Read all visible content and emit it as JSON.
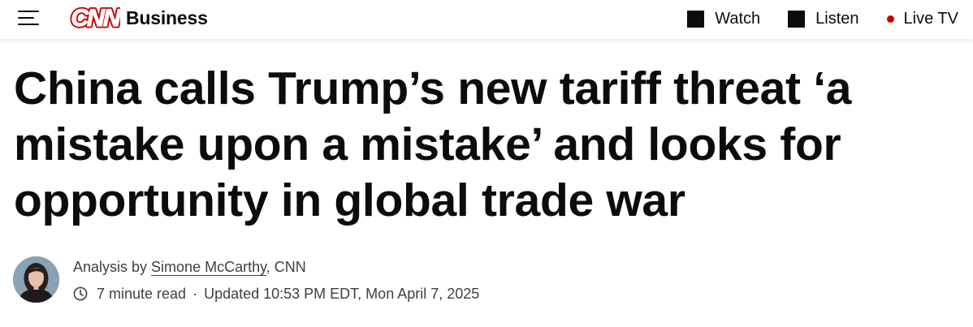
{
  "header": {
    "menu_icon": "hamburger-menu-icon",
    "logo_text": "CNN",
    "section": "Business",
    "nav": [
      {
        "label": "Watch",
        "icon": "square-icon"
      },
      {
        "label": "Listen",
        "icon": "square-icon"
      },
      {
        "label": "Live TV",
        "icon": "live-dot-icon"
      }
    ]
  },
  "article": {
    "headline": "China calls Trump’s new tariff threat ‘a mistake upon a mistake’ and looks for opportunity in global trade war",
    "byline": {
      "prefix": "Analysis by ",
      "author": "Simone McCarthy",
      "suffix": ", CNN"
    },
    "read_time": "7 minute read",
    "separator": "·",
    "updated": "Updated 10:53 PM EDT, Mon April 7, 2025"
  },
  "colors": {
    "brand_red": "#cc0000",
    "live_dot": "#cc0000",
    "text_primary": "#0c0c0c",
    "text_secondary": "#404040"
  }
}
